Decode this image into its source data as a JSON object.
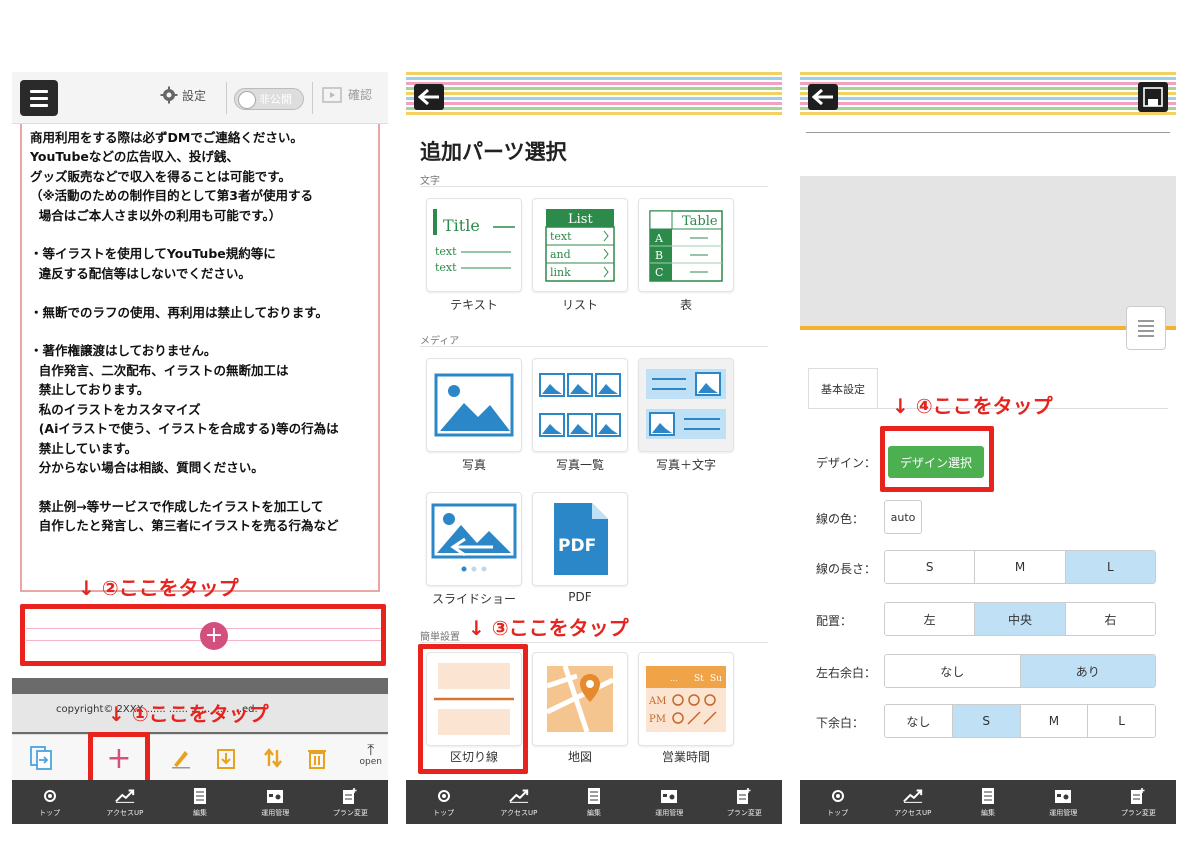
{
  "colors": {
    "annotation": "#e8231e",
    "plus_button": "#d34f7e",
    "design_button": "#4caf50",
    "segment_selected": "#bfe0f5",
    "nav_bar": "#3b3b3b"
  },
  "bottom_nav": [
    {
      "label": "トップ",
      "icon": "top-icon"
    },
    {
      "label": "アクセスUP",
      "icon": "chart-up-icon"
    },
    {
      "label": "編集",
      "icon": "document-icon"
    },
    {
      "label": "運用管理",
      "icon": "calendar-icon"
    },
    {
      "label": "プラン変更",
      "icon": "plan-change-icon"
    }
  ],
  "panel1": {
    "header": {
      "settings_label": "設定",
      "toggle_label": "非公開",
      "confirm_label": "確認"
    },
    "content_lines": [
      "商用利用をする際は必ずDMでご連絡ください。",
      "YouTubeなどの広告収入、投げ銭、",
      "グッズ販売などで収入を得ることは可能です。",
      "（※活動のための制作目的として第3者が使用する",
      "  場合はご本人さま以外の利用も可能です。）",
      "",
      "・等イラストを使用してYouTube規約等に",
      "  違反する配信等はしないでください。",
      "",
      "・無断でのラフの使用、再利用は禁止しております。",
      "",
      "・著作権譲渡はしておりません。",
      "  自作発言、二次配布、イラストの無断加工は",
      "  禁止しております。",
      "  私のイラストをカスタマイズ",
      "  (Aiイラストで使う、イラストを合成する)等の行為は",
      "  禁止しています。",
      "  分からない場合は相談、質問ください。",
      "",
      "  禁止例→等サービスで作成したイラストを加工して",
      "  自作したと発言し、第三者にイラストを売る行為など"
    ],
    "annotation_step2": "↓ ②ここをタップ",
    "annotation_step1": "↓ ①ここをタップ",
    "copyright": "copyright© 2XXX ...... ...... ...... ..... ...ed.",
    "toolbar": {
      "open_label": "open"
    }
  },
  "panel2": {
    "title": "追加パーツ選択",
    "section_text": "文字",
    "section_media": "メディア",
    "section_simple": "簡単設置",
    "annotation_step3": "↓ ③ここをタップ",
    "text_tiles": [
      {
        "label": "テキスト",
        "icon": "text-part-icon"
      },
      {
        "label": "リスト",
        "icon": "list-part-icon"
      },
      {
        "label": "表",
        "icon": "table-part-icon"
      }
    ],
    "media_tiles": [
      {
        "label": "写真",
        "icon": "photo-icon"
      },
      {
        "label": "写真一覧",
        "icon": "photo-list-icon"
      },
      {
        "label": "写真＋文字",
        "icon": "photo-text-icon"
      },
      {
        "label": "スライドショー",
        "icon": "slideshow-icon"
      },
      {
        "label": "PDF",
        "icon": "pdf-icon"
      }
    ],
    "simple_tiles": [
      {
        "label": "区切り線",
        "icon": "divider-icon"
      },
      {
        "label": "地図",
        "icon": "map-icon"
      },
      {
        "label": "営業時間",
        "icon": "business-hours-icon"
      }
    ],
    "icon_text": {
      "title": "Title",
      "text": "text",
      "list": "List",
      "and": "and",
      "link": "link",
      "table": "Table",
      "a": "A",
      "b": "B",
      "c": "C",
      "pdf": "PDF",
      "st": "St",
      "su": "Su",
      "am": "AM",
      "pm": "PM",
      "dots": "..."
    }
  },
  "panel3": {
    "tab_basic": "基本設定",
    "annotation_step4": "↓ ④ここをタップ",
    "design_label": "デザイン：",
    "design_button": "デザイン選択",
    "color_label": "線の色：",
    "color_value": "auto",
    "length_label": "線の長さ：",
    "length_options": [
      "S",
      "M",
      "L"
    ],
    "length_selected": "L",
    "align_label": "配置：",
    "align_options": [
      "左",
      "中央",
      "右"
    ],
    "align_selected": "中央",
    "side_margin_label": "左右余白：",
    "side_margin_options": [
      "なし",
      "あり"
    ],
    "side_margin_selected": "あり",
    "bottom_margin_label": "下余白：",
    "bottom_margin_options": [
      "なし",
      "S",
      "M",
      "L"
    ],
    "bottom_margin_selected": "S"
  }
}
